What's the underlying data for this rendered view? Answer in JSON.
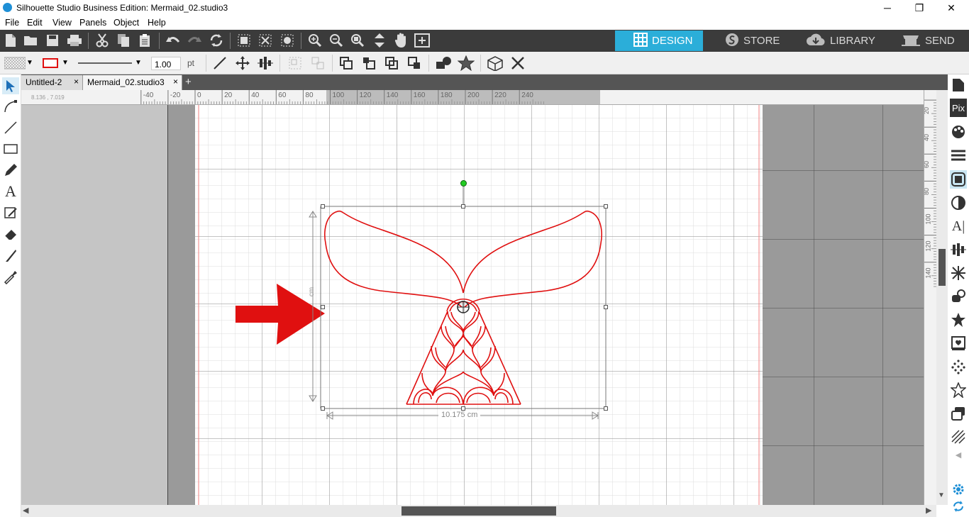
{
  "window": {
    "title": "Silhouette Studio Business Edition: Mermaid_02.studio3",
    "minimize": "─",
    "maximize": "❐",
    "close": "✕"
  },
  "menu": [
    "File",
    "Edit",
    "View",
    "Panels",
    "Object",
    "Help"
  ],
  "nav_tabs": [
    {
      "label": "DESIGN",
      "icon": "grid-icon",
      "active": true
    },
    {
      "label": "STORE",
      "icon": "silhouette-logo-icon",
      "active": false
    },
    {
      "label": "LIBRARY",
      "icon": "cloud-download-icon",
      "active": false
    },
    {
      "label": "SEND",
      "icon": "cutter-icon",
      "active": false
    }
  ],
  "toolbar2": {
    "line_width": "1.00",
    "line_unit": "pt"
  },
  "doc_tabs": [
    {
      "label": "Untitled-2",
      "close": "×",
      "active": false
    },
    {
      "label": "Mermaid_02.studio3",
      "close": "×",
      "active": true
    }
  ],
  "add_tab": "+",
  "ruler": {
    "coords": "8.136 , 7.019",
    "h_labels": [
      "-40",
      "-20",
      "0",
      "20",
      "40",
      "60",
      "80",
      "100",
      "120",
      "140",
      "160",
      "180",
      "200",
      "220",
      "240"
    ],
    "v_labels": [
      "20",
      "40",
      "60",
      "80",
      "100",
      "120",
      "140"
    ]
  },
  "selection": {
    "width_label": "10.175 cm",
    "height_label": "cm"
  },
  "colors": {
    "accent": "#2baed9",
    "design_red": "#e01010",
    "toolbar_dark": "#3b3b3b",
    "rotate_handle": "#22cc22"
  }
}
